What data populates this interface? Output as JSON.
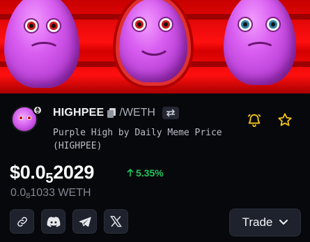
{
  "banner": {
    "alt_icons": [
      "sad-blob",
      "happy-blob",
      "sad-blob-blue-eyes"
    ]
  },
  "token": {
    "symbol": "HIGHPEE",
    "pair": "/WETH",
    "name": "Purple High by Daily Meme Price (HIGHPEE)",
    "chain_icon": "ethereum-icon",
    "copy_icon": "copy-icon",
    "swap_icon": "swap-arrows-icon"
  },
  "price": {
    "prefix": "$0.0",
    "zeros_sub": "5",
    "digits": "2029",
    "change": "5.35%",
    "change_color": "#22c55e",
    "weth_prefix": "0.0",
    "weth_sub": "8",
    "weth_digits": "1033 WETH"
  },
  "actions": {
    "alert_icon": "bell-alert-icon",
    "favorite_icon": "star-icon",
    "accent": "#f5c518"
  },
  "social": {
    "items": [
      "link-icon",
      "discord-icon",
      "telegram-icon",
      "x-icon"
    ]
  },
  "trade": {
    "label": "Trade",
    "icon": "chevron-down-icon"
  }
}
